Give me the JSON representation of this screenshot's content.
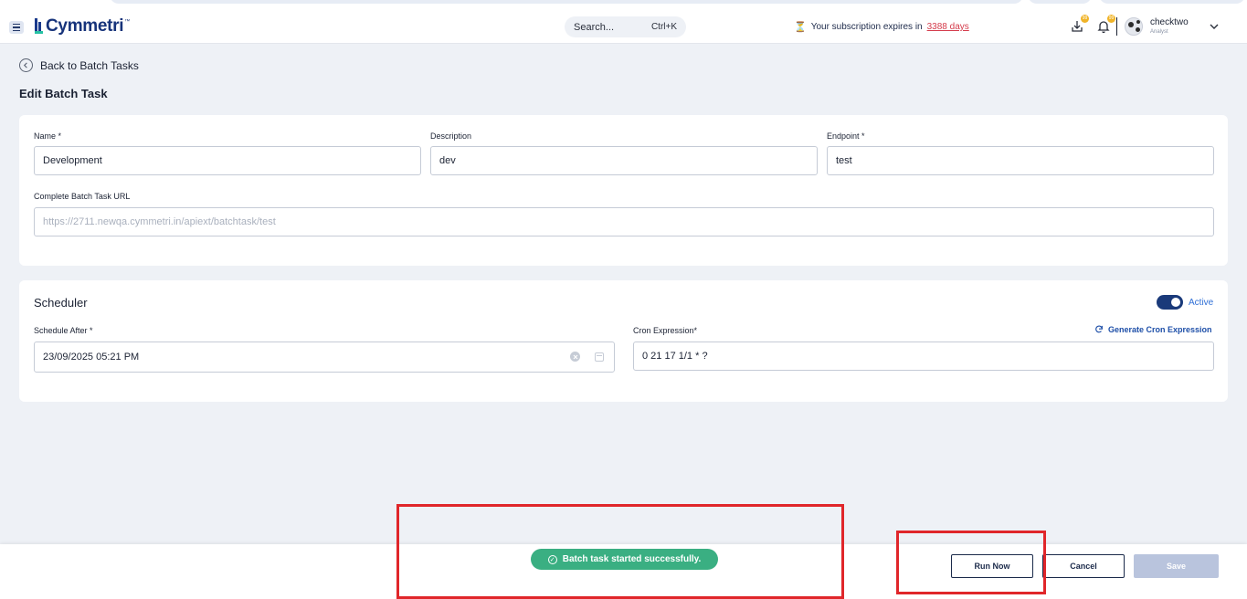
{
  "header": {
    "logo_text": "Cymmetri",
    "logo_tm": "™",
    "search_placeholder": "Search...",
    "search_shortcut": "Ctrl+K",
    "subscription_prefix": "Your subscription expires in",
    "subscription_days": "3388 days",
    "download_badge": "99",
    "notification_badge": "99",
    "user_name": "checktwo",
    "user_role": "Analyst"
  },
  "nav": {
    "back_label": "Back to Batch Tasks",
    "page_title": "Edit Batch Task"
  },
  "form": {
    "name_label": "Name *",
    "name_value": "Development",
    "description_label": "Description",
    "description_value": "dev",
    "endpoint_label": "Endpoint *",
    "endpoint_value": "test",
    "url_label": "Complete Batch Task URL",
    "url_value": "https://2711.newqa.cymmetri.in/apiext/batchtask/test"
  },
  "scheduler": {
    "title": "Scheduler",
    "status_label": "Active",
    "status_on": true,
    "schedule_after_label": "Schedule After *",
    "schedule_after_value": "23/09/2025 05:21 PM",
    "cron_label": "Cron Expression*",
    "cron_value": "0 21 17 1/1 * ?",
    "generate_cron_label": "Generate Cron Expression"
  },
  "footer": {
    "toast_message": "Batch task started successfully.",
    "run_now_label": "Run Now",
    "cancel_label": "Cancel",
    "save_label": "Save"
  },
  "colors": {
    "brand": "#16337a",
    "accent": "#26c1a3",
    "toast": "#3aaf82",
    "highlight": "#e0262a",
    "save_disabled": "#b9c4dd"
  }
}
